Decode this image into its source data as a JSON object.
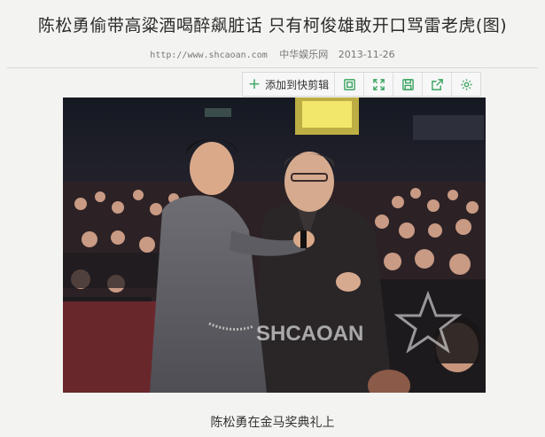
{
  "article": {
    "title": "陈松勇偷带高粱酒喝醉飙脏话 只有柯俊雄敢开口骂雷老虎(图)",
    "url": "http://www.shcaoan.com",
    "source": "中华娱乐网",
    "date": "2013-11-26"
  },
  "toolbar": {
    "add_label": "添加到快剪辑",
    "icons": [
      "plus-icon",
      "frame-icon",
      "expand-icon",
      "save-icon",
      "share-icon",
      "settings-icon"
    ]
  },
  "photo": {
    "watermark": "SHCAOAN"
  },
  "caption": "陈松勇在金马奖典礼上",
  "colors": {
    "accent_green": "#3da562",
    "background": "#f3f3f1"
  }
}
